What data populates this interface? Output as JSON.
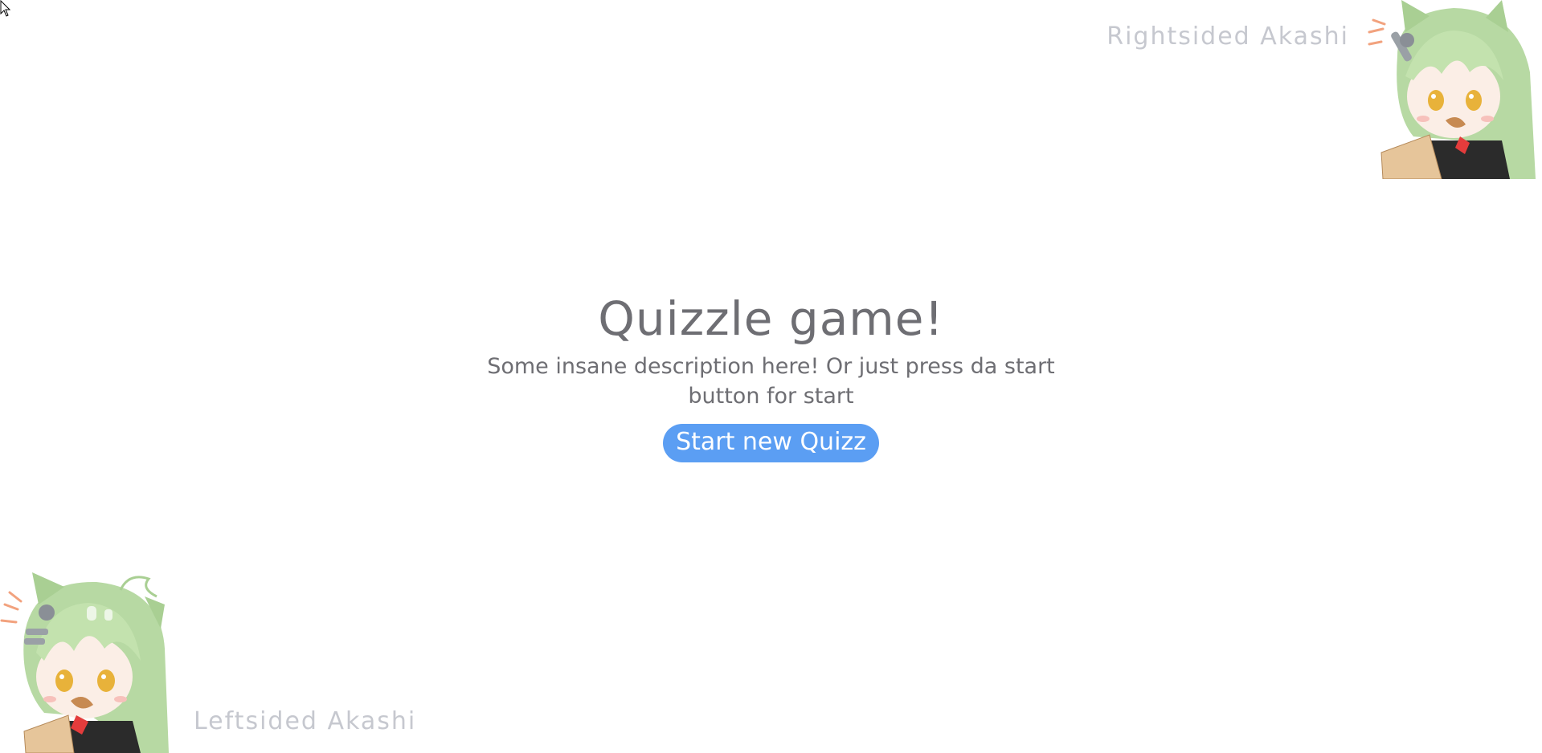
{
  "corners": {
    "right_label": "Rightsided Akashi",
    "left_label": "Leftsided Akashi"
  },
  "main": {
    "title": "Quizzle game!",
    "description": "Some insane description here! Or just press da start button for start",
    "start_button": "Start new Quizz"
  },
  "colors": {
    "button": "#5b9ef3",
    "text": "#6e6e73",
    "label": "#c6c8cf"
  }
}
